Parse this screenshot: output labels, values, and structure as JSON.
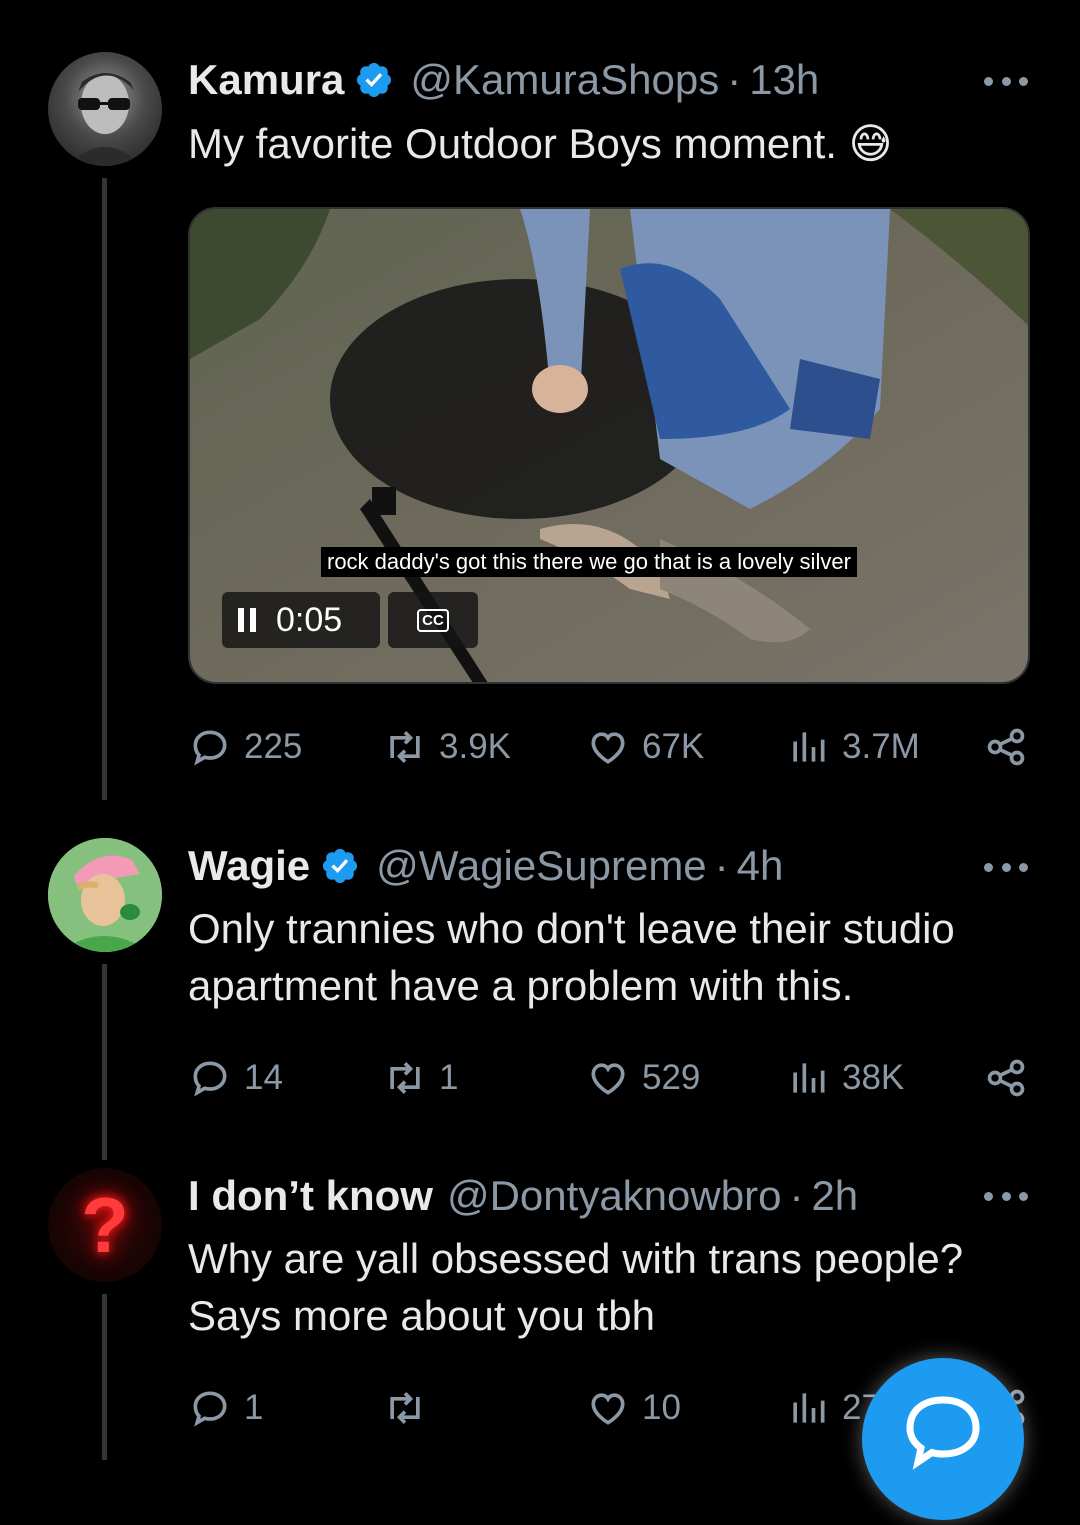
{
  "tweets": [
    {
      "name": "Kamura",
      "handle": "@KamuraShops",
      "time": "13h",
      "text": "My favorite Outdoor Boys moment.",
      "emoji": "😅",
      "verified": true,
      "video": {
        "caption": "rock daddy's got this there we go that is a lovely silver",
        "time": "0:05",
        "cc_label": "CC"
      },
      "stats": {
        "replies": "225",
        "retweets": "3.9K",
        "likes": "67K",
        "views": "3.7M"
      }
    },
    {
      "name": "Wagie",
      "handle": "@WagieSupreme",
      "time": "4h",
      "text_line1": "Only trannies who don't leave their studio",
      "text_line2": "apartment have a problem with this.",
      "verified": true,
      "stats": {
        "replies": "14",
        "retweets": "1",
        "likes": "529",
        "views": "38K"
      }
    },
    {
      "name": "I don’t know",
      "handle": "@Dontyaknowbro",
      "time": "2h",
      "text_line1": "Why are yall obsessed with trans people?",
      "text_line2": "Says more about you tbh",
      "avatar_glyph": "?",
      "stats": {
        "replies": "1",
        "retweets": "",
        "likes": "10",
        "views": "27"
      }
    }
  ],
  "separator": "·",
  "colors": {
    "accent": "#1d9bf0",
    "muted": "#8b98a5",
    "background": "#000000",
    "text": "#e7e9ea"
  }
}
